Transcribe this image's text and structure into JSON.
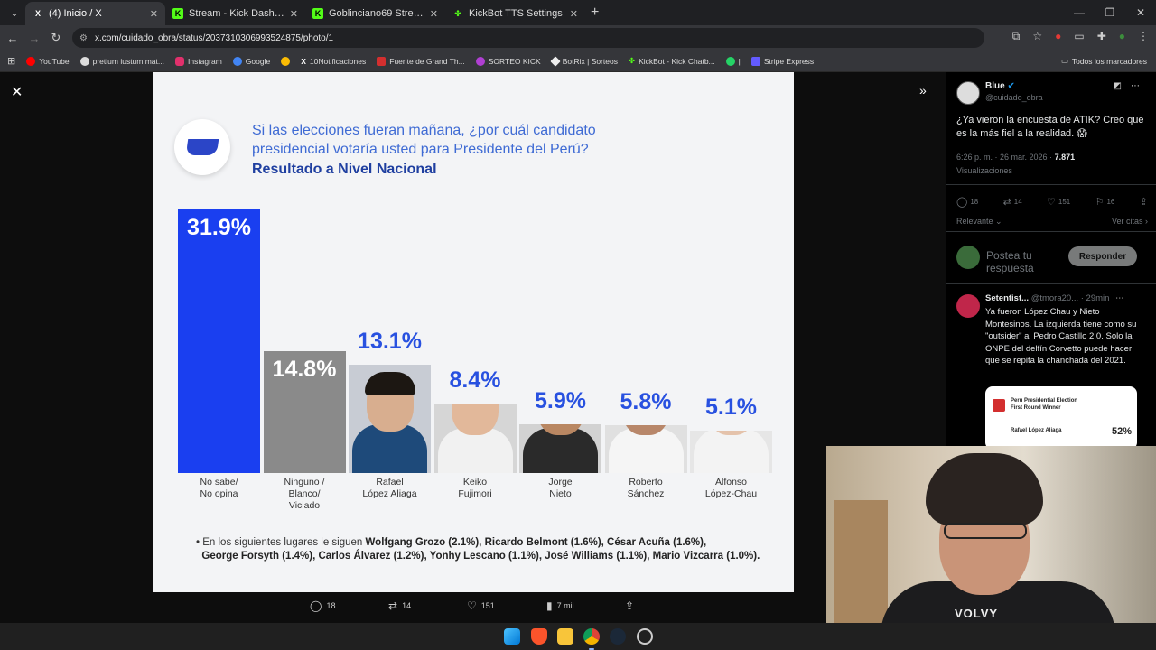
{
  "browser": {
    "tabs": [
      {
        "title": "(4) Inicio / X",
        "favicon": "x-logo-icon",
        "active": true
      },
      {
        "title": "Stream - Kick Dashboard",
        "favicon": "kick-logo-icon",
        "active": false
      },
      {
        "title": "Goblinciano69 Stream - Watch",
        "favicon": "kick-logo-icon",
        "active": false
      },
      {
        "title": "KickBot TTS Settings",
        "favicon": "kickbot-logo-icon",
        "active": false
      }
    ],
    "url": "x.com/cuidado_obra/status/2037310306993524875/photo/1",
    "bookmarks": [
      {
        "label": "YouTube",
        "color": "#ff0000"
      },
      {
        "label": "pretium iustum mat...",
        "color": "#dddddd"
      },
      {
        "label": "Instagram",
        "color": "#e1306c"
      },
      {
        "label": "Google",
        "color": "#4285f4"
      },
      {
        "label": "",
        "color": "#fbbc04"
      },
      {
        "label": "10Notificaciones",
        "color": "#ffffff"
      },
      {
        "label": "Fuente de Grand Th...",
        "color": "#d32f2f"
      },
      {
        "label": "SORTEO KICK",
        "color": "#b03fd3"
      },
      {
        "label": "BotRix | Sorteos",
        "color": "#eeeeee"
      },
      {
        "label": "KickBot - Kick Chatb...",
        "color": "#53fc18"
      },
      {
        "label": "|",
        "color": "#25d366"
      },
      {
        "label": "Stripe Express",
        "color": "#635bff"
      }
    ],
    "all_bookmarks_label": "Todos los marcadores"
  },
  "poll": {
    "question_line1": "Si las elecciones fueran mañana, ¿por cuál candidato",
    "question_line2": "presidencial votaría usted para Presidente del Perú?",
    "subtitle": "Resultado a Nivel Nacional",
    "footnote_intro": "En los siguientes lugares le siguen",
    "footnote_line1": "Wolfgang Grozo (2.1%), Ricardo Belmont (1.6%), César Acuña (1.6%),",
    "footnote_line2": "George Forsyth (1.4%), Carlos Álvarez (1.2%), Yonhy Lescano (1.1%), José Williams (1.1%), Mario Vizcarra (1.0%)."
  },
  "chart_data": {
    "type": "bar",
    "title": "Si las elecciones fueran mañana, ¿por cuál candidato presidencial votaría usted para Presidente del Perú?",
    "subtitle": "Resultado a Nivel Nacional",
    "categories": [
      "No sabe/ No opina",
      "Ninguno / Blanco/ Viciado",
      "Rafael López Aliaga",
      "Keiko Fujimori",
      "Jorge Nieto",
      "Roberto Sánchez",
      "Alfonso López-Chau"
    ],
    "values": [
      31.9,
      14.8,
      13.1,
      8.4,
      5.9,
      5.8,
      5.1
    ],
    "labels": [
      "31.9%",
      "14.8%",
      "13.1%",
      "8.4%",
      "5.9%",
      "5.8%",
      "5.1%"
    ],
    "candidates": [
      {
        "line1": "No sabe/",
        "line2": "No opina",
        "line3": ""
      },
      {
        "line1": "Ninguno /",
        "line2": "Blanco/",
        "line3": "Viciado"
      },
      {
        "line1": "Rafael",
        "line2": "López Aliaga",
        "line3": ""
      },
      {
        "line1": "Keiko",
        "line2": "Fujimori",
        "line3": ""
      },
      {
        "line1": "Jorge",
        "line2": "Nieto",
        "line3": ""
      },
      {
        "line1": "Roberto",
        "line2": "Sánchez",
        "line3": ""
      },
      {
        "line1": "Alfonso",
        "line2": "López-Chau",
        "line3": ""
      }
    ],
    "colors": {
      "no_sabe": "#1a3ff0",
      "ninguno": "#8a8a8a",
      "label_blue": "#2851e0"
    }
  },
  "photo_actions": {
    "replies": "18",
    "reposts": "14",
    "likes": "151",
    "views": "7 mil"
  },
  "tweet": {
    "author": "Blue",
    "handle": "@cuidado_obra",
    "text": "¿Ya vieron la encuesta de ATIK? Creo que es la más fiel a la realidad. 😱",
    "time": "6:26 p. m. · 26 mar. 2026 ·",
    "views_count": "7.871",
    "views_label": "Visualizaciones",
    "replies": "18",
    "reposts": "14",
    "likes": "151",
    "bookmarks": "16",
    "sort_label": "Relevante",
    "quotes_label": "Ver citas",
    "reply_placeholder": "Postea tu respuesta",
    "reply_button": "Responder"
  },
  "reply": {
    "author": "Setentist...",
    "handle": "@tmora20...",
    "time": "· 29min",
    "text": "Ya fueron López Chau y Nieto Montesinos. La izquierda tiene como su \"outsider\" al Pedro Castillo 2.0. Solo la ONPE del delfín Corvetto puede hacer que se repita la chanchada del 2021.",
    "card_title_line1": "Peru Presidential Election",
    "card_title_line2": "First Round Winner",
    "card_candidate": "Rafael López Aliaga",
    "card_pct": "52%"
  },
  "webcam": {
    "shirt_text": "VOLVY"
  }
}
